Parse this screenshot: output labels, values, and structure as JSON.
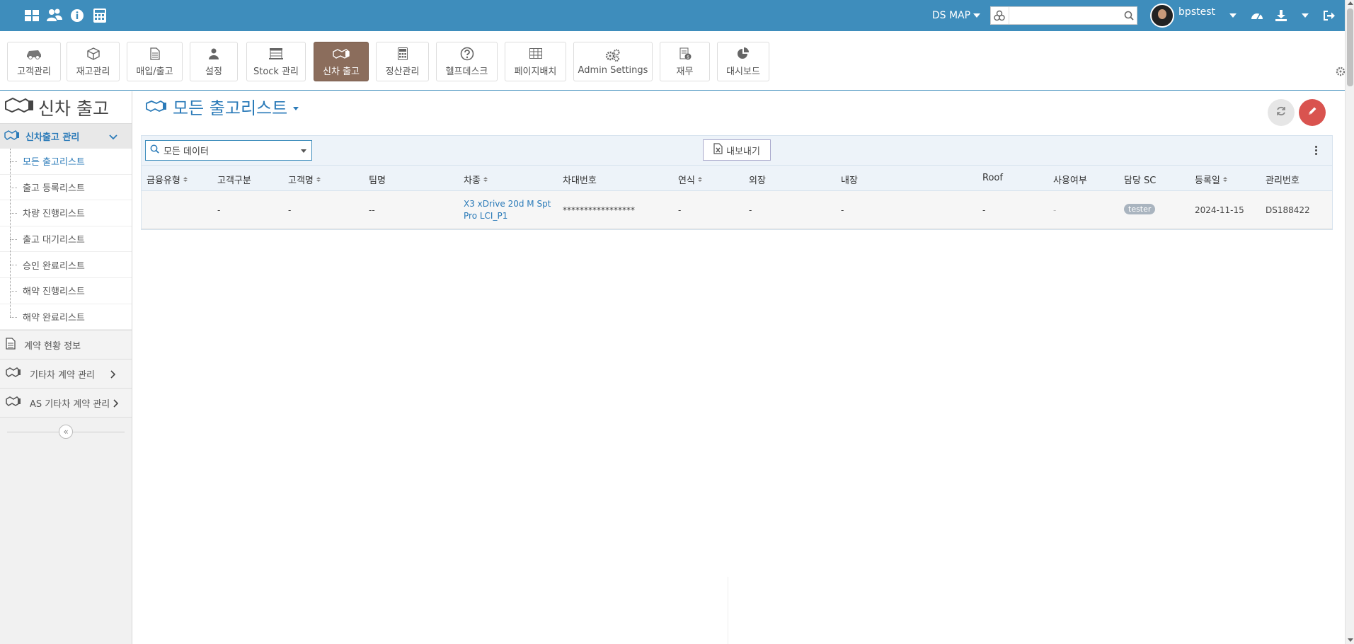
{
  "topbar": {
    "left_icons": [
      "dashboard-icon",
      "users-icon",
      "info-icon",
      "calculator-icon"
    ],
    "ds_map_label": "DS MAP",
    "search": {
      "value": "",
      "placeholder": ""
    },
    "username": "bpstest",
    "right_icons": [
      "tachometer-icon",
      "download-icon",
      "logout-icon"
    ],
    "bg_color": "#3e8dbc"
  },
  "modules": [
    {
      "label": "고객관리",
      "icon": "car-icon"
    },
    {
      "label": "재고관리",
      "icon": "cube-icon"
    },
    {
      "label": "매입/출고",
      "icon": "document-icon"
    },
    {
      "label": "설정",
      "icon": "user-icon"
    },
    {
      "label": "Stock 관리",
      "icon": "building-icon"
    },
    {
      "label": "신차 출고",
      "icon": "handshake-icon",
      "active": true
    },
    {
      "label": "정산관리",
      "icon": "calculator-icon"
    },
    {
      "label": "헬프데스크",
      "icon": "question-icon"
    },
    {
      "label": "페이지배치",
      "icon": "table-icon"
    },
    {
      "label": "Admin Settings",
      "icon": "gears-icon"
    },
    {
      "label": "재무",
      "icon": "money-icon"
    },
    {
      "label": "대시보드",
      "icon": "pie-chart-icon"
    }
  ],
  "sidebar": {
    "title": "신차 출고",
    "section_label": "신차출고 관리",
    "items": [
      {
        "label": "모든 출고리스트",
        "active": true
      },
      {
        "label": "출고 등록리스트"
      },
      {
        "label": "차량 진행리스트"
      },
      {
        "label": "출고 대기리스트"
      },
      {
        "label": "승인 완료리스트"
      },
      {
        "label": "해약 진행리스트"
      },
      {
        "label": "해약 완료리스트"
      }
    ],
    "groups": [
      {
        "label": "계약 현황 정보",
        "icon": "document-icon",
        "expandable": false
      },
      {
        "label": "기타차 계약 관리",
        "icon": "handshake-icon",
        "expandable": true
      },
      {
        "label": "AS 기타차 계약 관리",
        "icon": "handshake-icon",
        "expandable": true
      }
    ],
    "collapse_glyph": "«"
  },
  "main": {
    "page_title": "모든 출고리스트",
    "filter_label": "모든 데이터",
    "export_label": "내보내기",
    "columns": [
      "금융유형",
      "고객구분",
      "고객명",
      "팀명",
      "차종",
      "차대번호",
      "연식",
      "외장",
      "내장",
      "Roof",
      "사용여부",
      "담당 SC",
      "등록일",
      "관리번호"
    ],
    "sortable_columns": [
      "금융유형",
      "고객명",
      "차종",
      "연식",
      "등록일"
    ],
    "rows": [
      {
        "finance_type": "",
        "customer_type": "-",
        "customer_name": "-",
        "team": "--",
        "model": "X3 xDrive 20d M Spt Pro LCI_P1",
        "vin": "*****************",
        "year": "-",
        "exterior": "-",
        "interior": "-",
        "roof": "-",
        "in_use": "-",
        "sc": "tester",
        "reg_date": "2024-11-15",
        "mgmt_no": "DS188422"
      }
    ]
  },
  "colors": {
    "accent": "#2a7ab8",
    "active_module": "#8b6d5c",
    "edit_button": "#d9534f"
  }
}
